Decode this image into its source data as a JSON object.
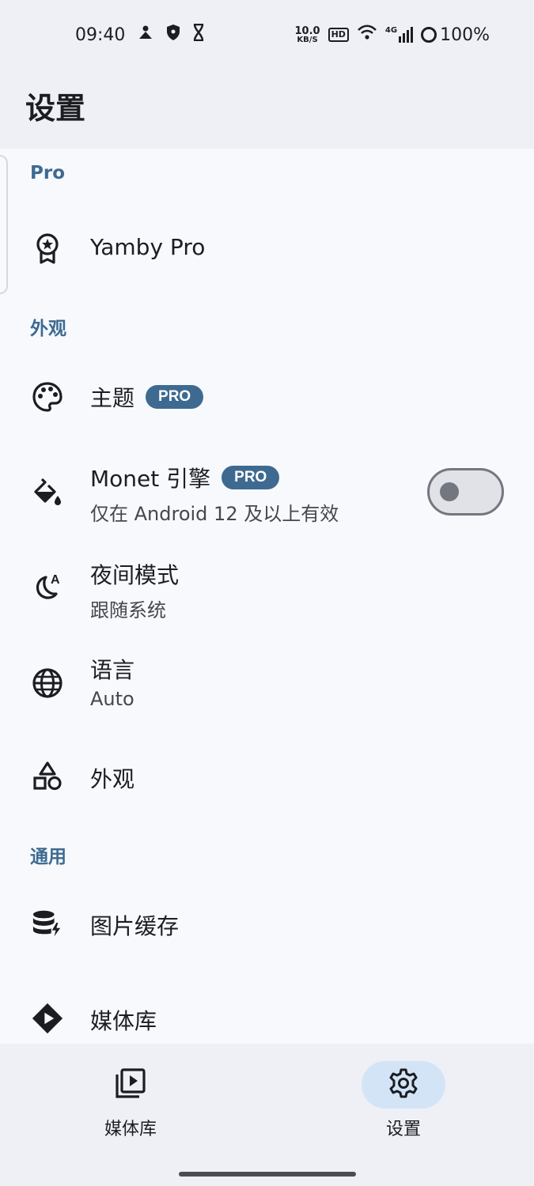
{
  "status_bar": {
    "time": "09:40",
    "net_speed_value": "10.0",
    "net_speed_unit": "KB/S",
    "hd": "HD",
    "network": "4G",
    "battery": "100%"
  },
  "app_bar": {
    "title": "设置"
  },
  "sections": {
    "pro": {
      "header": "Pro",
      "yamby_pro": {
        "title": "Yamby Pro",
        "icon": "award-icon"
      }
    },
    "appearance": {
      "header": "外观",
      "theme": {
        "title": "主题",
        "badge": "PRO",
        "icon": "palette-icon"
      },
      "monet": {
        "title": "Monet 引擎",
        "badge": "PRO",
        "subtitle": "仅在 Android 12 及以上有效",
        "icon": "format-paint-icon",
        "enabled": false
      },
      "night_mode": {
        "title": "夜间模式",
        "subtitle": "跟随系统",
        "icon": "night-mode-auto-icon"
      },
      "language": {
        "title": "语言",
        "subtitle": "Auto",
        "icon": "globe-icon"
      },
      "appearance": {
        "title": "外观",
        "icon": "shapes-icon"
      }
    },
    "general": {
      "header": "通用",
      "image_cache": {
        "title": "图片缓存",
        "icon": "database-bolt-icon"
      },
      "media_library": {
        "title": "媒体库",
        "icon": "media-diamond-icon"
      }
    }
  },
  "bottom_nav": {
    "items": [
      {
        "label": "媒体库",
        "icon": "video-library-icon",
        "active": false
      },
      {
        "label": "设置",
        "icon": "gear-icon",
        "active": true
      }
    ]
  },
  "colors": {
    "accent": "#3e6a91",
    "background": "#f7f9fd",
    "bar_background": "#eef0f5",
    "active_pill": "#d3e4f7"
  }
}
